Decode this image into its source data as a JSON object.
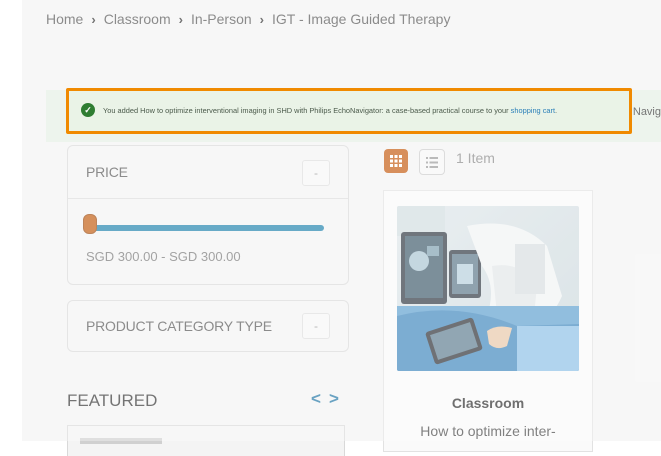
{
  "breadcrumb": {
    "items": [
      "Home",
      "Classroom",
      "In-Person",
      "IGT - Image Guided Therapy"
    ],
    "separator": "›"
  },
  "message": {
    "text_before": "You added How to optimize interventional imaging in SHD with Philips EchoNavigator: a case-based practical course to your ",
    "link_text": "shopping cart",
    "text_after": ".",
    "overflow_text": "Navig"
  },
  "filters": {
    "price": {
      "title": "PRICE",
      "toggle": "-",
      "range_text": "SGD 300.00 - SGD 300.00"
    },
    "category": {
      "title": "PRODUCT CATEGORY TYPE",
      "toggle": "-"
    }
  },
  "featured": {
    "title": "FEATURED",
    "prev": "<",
    "next": ">"
  },
  "toolbar": {
    "item_count": "1 Item"
  },
  "product": {
    "category": "Classroom",
    "name": "How to optimize inter-"
  },
  "colors": {
    "accent": "#c45b10",
    "highlight_border": "#f08a00",
    "success": "#2f7d32",
    "link": "#2a7fb8",
    "slider": "#1f82ad"
  }
}
